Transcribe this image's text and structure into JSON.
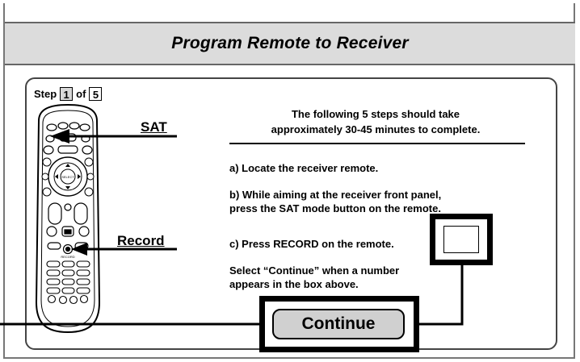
{
  "title": "Program Remote to Receiver",
  "step": {
    "prefix": "Step",
    "current": "1",
    "of_word": "of",
    "total": "5"
  },
  "intro": {
    "line1": "The following 5 steps should take",
    "line2": "approximately 30-45 minutes to complete."
  },
  "instructions": {
    "a": "a) Locate the receiver remote.",
    "b_line1": "b) While aiming at the receiver front panel,",
    "b_line2": "press the SAT mode button on the remote.",
    "c": "c) Press RECORD on the remote.",
    "select_line1": "Select “Continue” when a number",
    "select_line2": "appears in the box above."
  },
  "callouts": {
    "sat": "SAT",
    "record": "Record"
  },
  "remote": {
    "record_label": "RECORD"
  },
  "buttons": {
    "continue": "Continue"
  },
  "code_box": {
    "value": ""
  },
  "colors": {
    "titlebar_bg": "#dcdcdc",
    "button_bg": "#d0d0d0",
    "accent": "#000000"
  }
}
